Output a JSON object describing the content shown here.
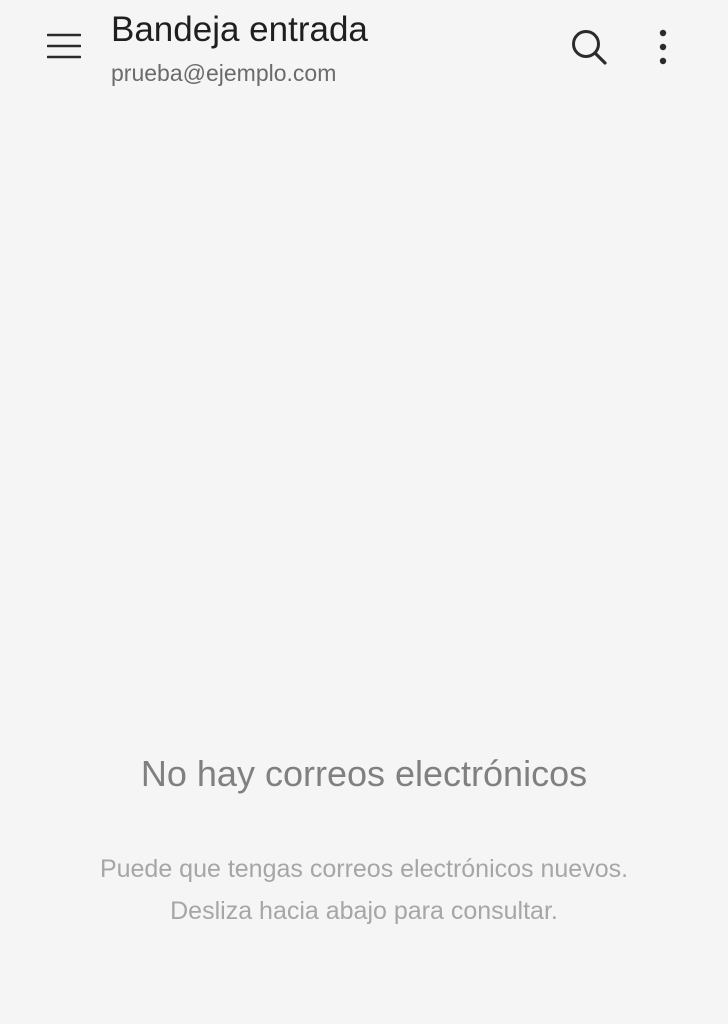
{
  "header": {
    "title": "Bandeja entrada",
    "account_email": "prueba@ejemplo.com",
    "icons": {
      "menu": "menu-icon",
      "search": "search-icon",
      "more": "more-vertical-icon"
    }
  },
  "empty_state": {
    "title": "No hay correos electrónicos",
    "message": "Puede que tengas correos electrónicos nuevos. Desliza hacia abajo para consultar."
  },
  "colors": {
    "background": "#f5f5f5",
    "title_text": "#1f1f1f",
    "secondary_text": "#6b6b6b",
    "empty_title_text": "#808080",
    "empty_message_text": "#a6a6a6",
    "icon": "#2b2b2b"
  }
}
